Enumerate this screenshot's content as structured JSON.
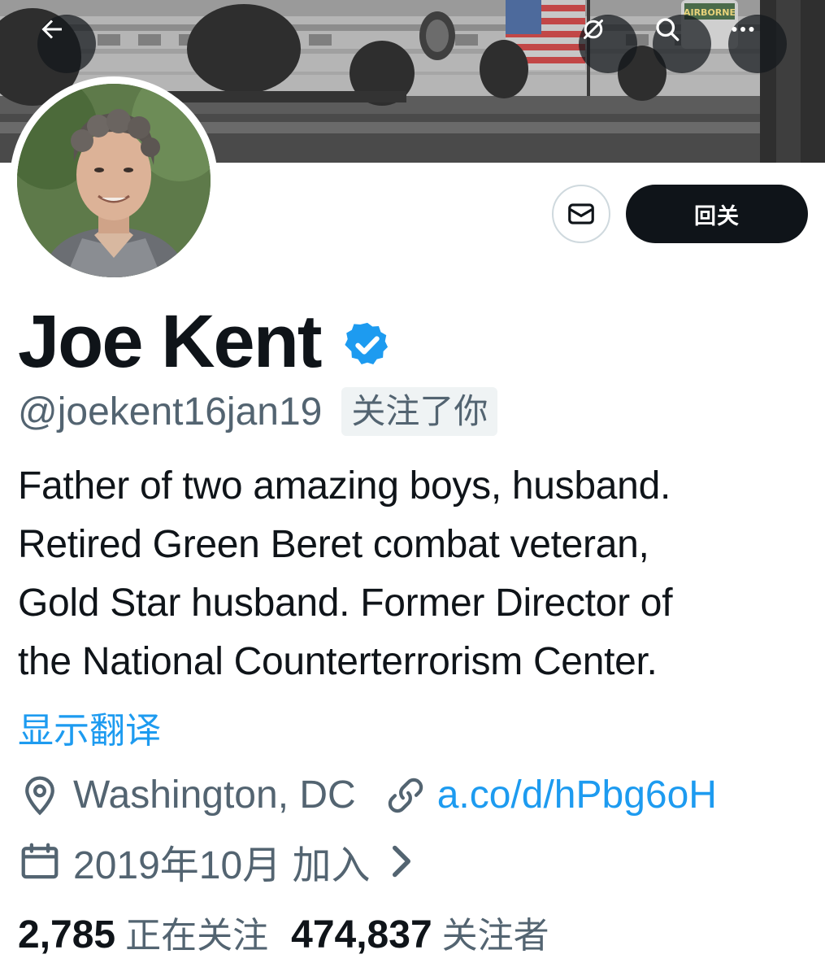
{
  "header": {
    "back_icon": "arrow-left-icon",
    "grok_icon": "slashed-circle-icon",
    "search_icon": "search-icon",
    "more_icon": "more-horizontal-icon"
  },
  "banner": {
    "patch_text": "AIRBORNE"
  },
  "actions": {
    "dm_icon": "envelope-icon",
    "follow_label": "回关"
  },
  "profile": {
    "name": "Joe Kent",
    "verified_icon": "verified-badge-icon",
    "handle": "@joekent16jan19",
    "follows_you": "关注了你",
    "bio_lines": [
      "Father of two amazing boys, husband.",
      "Retired Green Beret combat veteran,",
      "Gold Star husband. Former Director of",
      "the National Counterterrorism Center."
    ],
    "translate": "显示翻译",
    "location": "Washington, DC",
    "link": "a.co/d/hPbg6oH",
    "joined": "2019年10月 加入"
  },
  "stats": {
    "following_count": "2,785",
    "following_label": "正在关注",
    "followers_count": "474,837",
    "followers_label": "关注者"
  },
  "colors": {
    "accent": "#1d9bf0",
    "text": "#0f1419",
    "secondary": "#536471",
    "button_dark": "#0f1419"
  }
}
